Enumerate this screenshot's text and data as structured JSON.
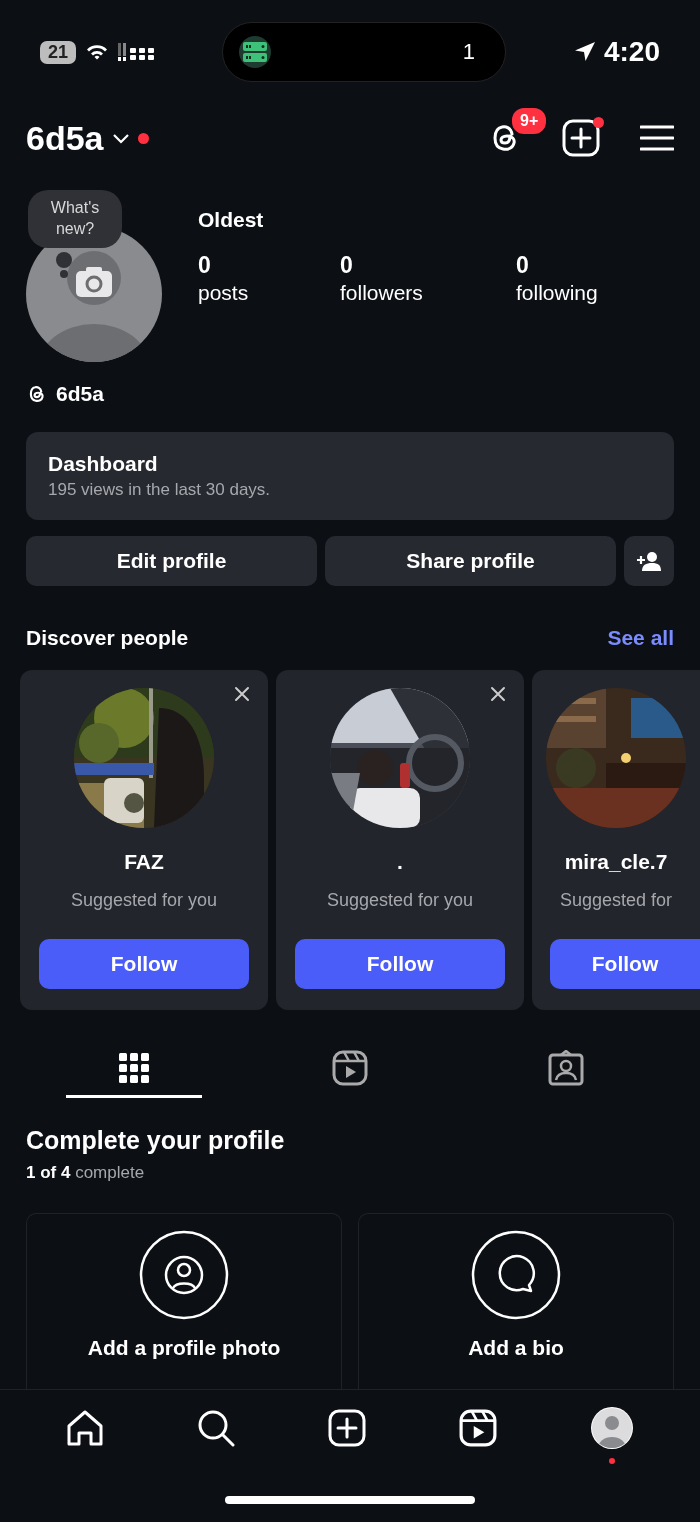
{
  "status_bar": {
    "battery": "21",
    "island_count": "1",
    "time": "4:20"
  },
  "header": {
    "username": "6d5a",
    "notification_dot": true,
    "threads_badge": "9+",
    "create_dot": true
  },
  "profile": {
    "bubble": "What's new?",
    "name": "Oldest",
    "stats": [
      {
        "value": "0",
        "label": "posts"
      },
      {
        "value": "0",
        "label": "followers"
      },
      {
        "value": "0",
        "label": "following"
      }
    ],
    "threads_handle": "6d5a"
  },
  "dashboard": {
    "title": "Dashboard",
    "subtitle": "195 views in the last 30 days."
  },
  "actions": [
    "Edit profile",
    "Share profile"
  ],
  "discover": {
    "title": "Discover people",
    "link": "See all",
    "cards": [
      {
        "name": "FAZ",
        "subtitle": "Suggested for you",
        "button": "Follow",
        "dismissible": true
      },
      {
        "name": ".",
        "subtitle": "Suggested for you",
        "button": "Follow",
        "dismissible": true
      },
      {
        "name": "mira_cle.7",
        "subtitle": "Suggested for",
        "button": "Follow",
        "dismissible": false
      }
    ]
  },
  "tabs": [
    {
      "selected": true
    },
    {
      "selected": false
    },
    {
      "selected": false
    }
  ],
  "complete": {
    "title": "Complete your profile",
    "progress": "**1 of 4** complete",
    "tasks": [
      "Add a profile photo",
      "Add a bio"
    ]
  },
  "bottom_nav": {
    "profile_dot": true
  }
}
